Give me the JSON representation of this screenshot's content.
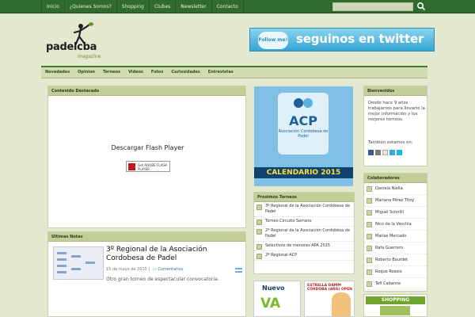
{
  "topnav": [
    "Inicio",
    "¿Quienes Somos?",
    "Shopping",
    "Clubes",
    "Newsletter",
    "Contacto"
  ],
  "logo": {
    "name": "padelcba",
    "tagline": "magazine"
  },
  "twitter_banner": {
    "follow": "Follow me!",
    "text": "seguinos en twitter"
  },
  "mainnav": [
    "Novedades",
    "Opinion",
    "Torneos",
    "Videos",
    "Fotos",
    "Curiosidades",
    "Entrevistas"
  ],
  "featured": {
    "heading": "Contenido Destacado",
    "flash_text": "Descargar Flash Player",
    "flash_button": "Get ADOBE FLASH PLAYER"
  },
  "notes": {
    "heading": "Ultimas Notas",
    "title": "3º Regional de la Asociación Cordobesa de Padel",
    "date": "15 de mayo de 2015",
    "separator": "|",
    "comments": "Comentarios",
    "desc": "Otro gran torneo de espectacular convocatoria."
  },
  "acp": {
    "abbr": "ACP",
    "sub": "Asociación Cordobesa de Padel",
    "calendar": "CALENDARIO 2015"
  },
  "tournaments": {
    "heading": "Proximos Torneos",
    "items": [
      "3º Regional de la Asociación Cordobesa de Padel",
      "Torneo Circuito Serrano",
      "2º Regional de la Asociación Cordobesa de Padel",
      "Selectivos de menores APA 2015",
      "2º Regional ACP"
    ]
  },
  "ad1": {
    "line1": "Nuevo",
    "line2": "VA"
  },
  "ad2": {
    "text": "ESTRELLA DAMM CÓRDOBA (ARG) OPEN"
  },
  "welcome": {
    "heading": "Bienvenidos",
    "text": "Desde hace 9 años trabajamos para llevarte la mejor información y los mejores torneos.",
    "also": "También estamos en:"
  },
  "collab": {
    "heading": "Colaboradores",
    "items": [
      "Daniela Niella",
      "Mariana Pérez Titoy",
      "Miguel Sciorilli",
      "Nico de la Vecchia",
      "Matías Mercado",
      "Rafa Guerrero",
      "Roberto Bourdet",
      "Roque Roasio",
      "Tefi Cabanne"
    ]
  },
  "shopping": "SHOPPING",
  "colors": {
    "topbar": "#2f6b2e",
    "accent": "#c2ce98",
    "bg": "#e4e8cf",
    "link": "#3a6ea8"
  }
}
